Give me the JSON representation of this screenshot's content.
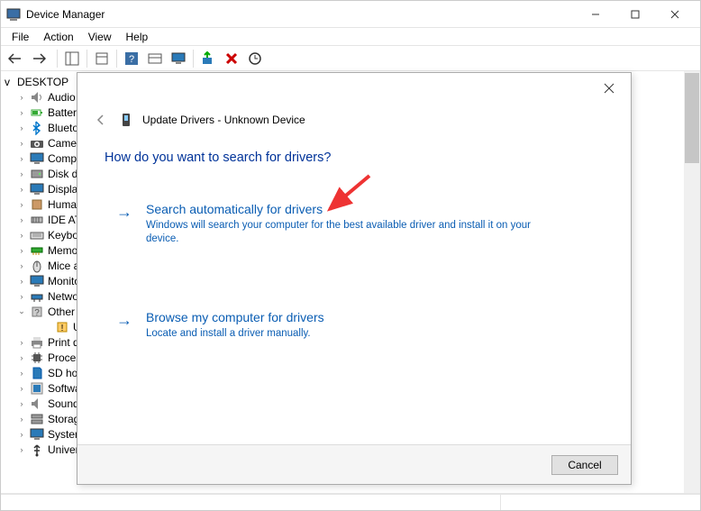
{
  "window": {
    "title": "Device Manager"
  },
  "menu": {
    "file": "File",
    "action": "Action",
    "view": "View",
    "help": "Help"
  },
  "tree": {
    "root": "DESKTOP",
    "items": [
      {
        "chevron": ">",
        "icon": "audio",
        "label": "Audio"
      },
      {
        "chevron": ">",
        "icon": "battery",
        "label": "Batteries"
      },
      {
        "chevron": ">",
        "icon": "bluetooth",
        "label": "Bluetooth"
      },
      {
        "chevron": ">",
        "icon": "camera",
        "label": "Cameras"
      },
      {
        "chevron": ">",
        "icon": "computer",
        "label": "Computer"
      },
      {
        "chevron": ">",
        "icon": "disk",
        "label": "Disk drives"
      },
      {
        "chevron": ">",
        "icon": "display",
        "label": "Display adapters"
      },
      {
        "chevron": ">",
        "icon": "hid",
        "label": "Human Interface Devices"
      },
      {
        "chevron": ">",
        "icon": "ide",
        "label": "IDE ATA/ATAPI controllers"
      },
      {
        "chevron": ">",
        "icon": "keyboard",
        "label": "Keyboards"
      },
      {
        "chevron": ">",
        "icon": "memory",
        "label": "Memory"
      },
      {
        "chevron": ">",
        "icon": "mouse",
        "label": "Mice and other pointing devices"
      },
      {
        "chevron": ">",
        "icon": "monitor",
        "label": "Monitors"
      },
      {
        "chevron": ">",
        "icon": "network",
        "label": "Network adapters"
      },
      {
        "chevron": "v",
        "icon": "other",
        "label": "Other devices",
        "child": {
          "icon": "unknown",
          "label": "Unknown device"
        }
      },
      {
        "chevron": ">",
        "icon": "printer",
        "label": "Print queues"
      },
      {
        "chevron": ">",
        "icon": "processor",
        "label": "Processors"
      },
      {
        "chevron": ">",
        "icon": "sd",
        "label": "SD host adapters"
      },
      {
        "chevron": ">",
        "icon": "software",
        "label": "Software components"
      },
      {
        "chevron": ">",
        "icon": "sound",
        "label": "Sound, video and game controllers"
      },
      {
        "chevron": ">",
        "icon": "storage",
        "label": "Storage controllers"
      },
      {
        "chevron": ">",
        "icon": "system",
        "label": "System devices"
      },
      {
        "chevron": ">",
        "icon": "usb",
        "label": "Universal Serial Bus controllers"
      }
    ]
  },
  "dialog": {
    "title": "Update Drivers - Unknown Device",
    "heading": "How do you want to search for drivers?",
    "option1": {
      "title": "Search automatically for drivers",
      "desc": "Windows will search your computer for the best available driver and install it on your device."
    },
    "option2": {
      "title": "Browse my computer for drivers",
      "desc": "Locate and install a driver manually."
    },
    "cancel": "Cancel"
  }
}
